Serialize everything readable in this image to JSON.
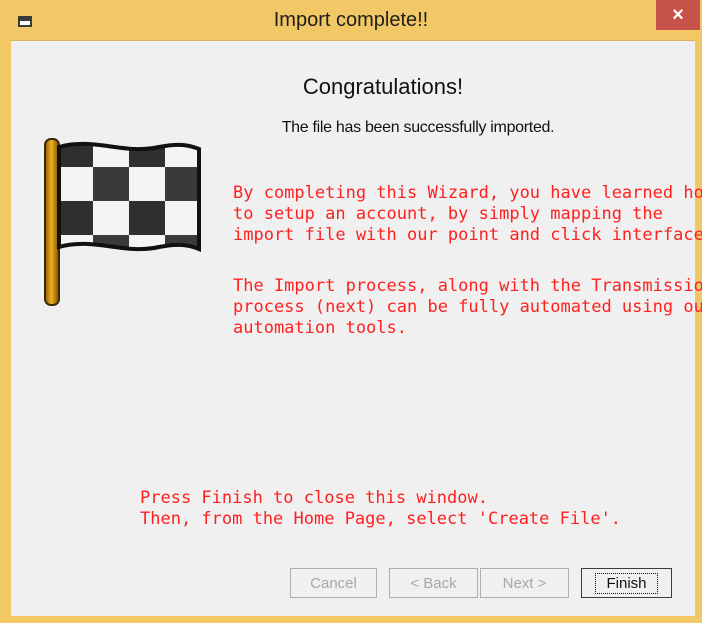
{
  "window": {
    "title": "Import complete!!",
    "close_glyph": "×"
  },
  "content": {
    "heading": "Congratulations!",
    "subheading": "The file has been successfully imported.",
    "paragraph1": "By completing this Wizard, you have learned how\nto setup an account, by simply mapping the\nimport file with our point and click interface.",
    "paragraph2": "The Import process, along with the Transmission\nprocess (next) can be fully automated using our\nautomation tools.",
    "bottom_note": "Press Finish to close this window.\nThen, from the Home Page, select 'Create File'."
  },
  "buttons": {
    "cancel": "Cancel",
    "back": "< Back",
    "next": "Next >",
    "finish": "Finish"
  },
  "icons": {
    "app": "app-window-icon",
    "flag": "checkered-flag-icon",
    "close": "close-icon"
  },
  "colors": {
    "frame": "#f2c766",
    "close_button": "#c7524a",
    "highlight_text": "#ff2020"
  }
}
